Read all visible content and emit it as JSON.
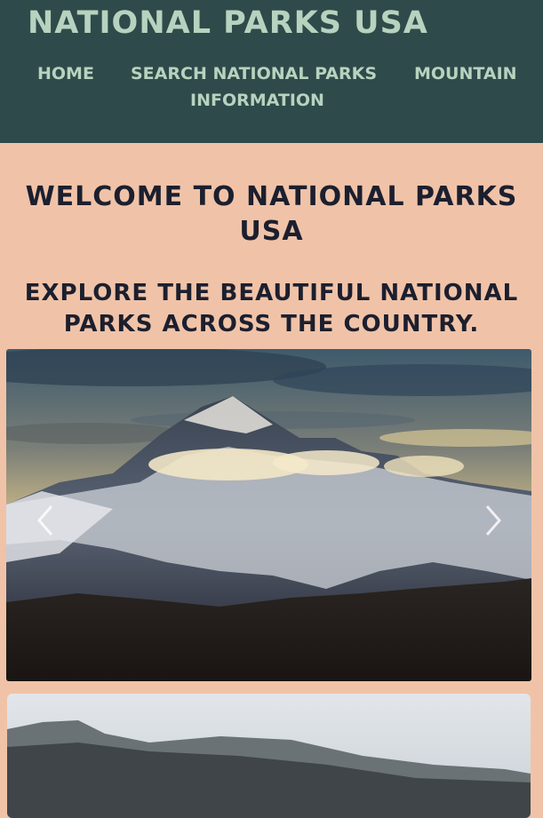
{
  "header": {
    "site_title": "National Parks USA",
    "nav": {
      "home": "Home",
      "search": "Search National Parks",
      "mountain_line1": "Mountain",
      "mountain_line2": "Information"
    }
  },
  "main": {
    "welcome_line1": "Welcome to National Parks",
    "welcome_line2": "USA",
    "explore_line1": "Explore the beautiful National",
    "explore_line2": "Parks across the country."
  },
  "carousel": {
    "prev_icon": "chevron-left-icon",
    "next_icon": "chevron-right-icon"
  },
  "colors": {
    "header_bg": "#2f4a4a",
    "nav_text": "#b7d3bf",
    "page_bg": "#f0c3a8",
    "heading_text": "#1c1f2e"
  }
}
